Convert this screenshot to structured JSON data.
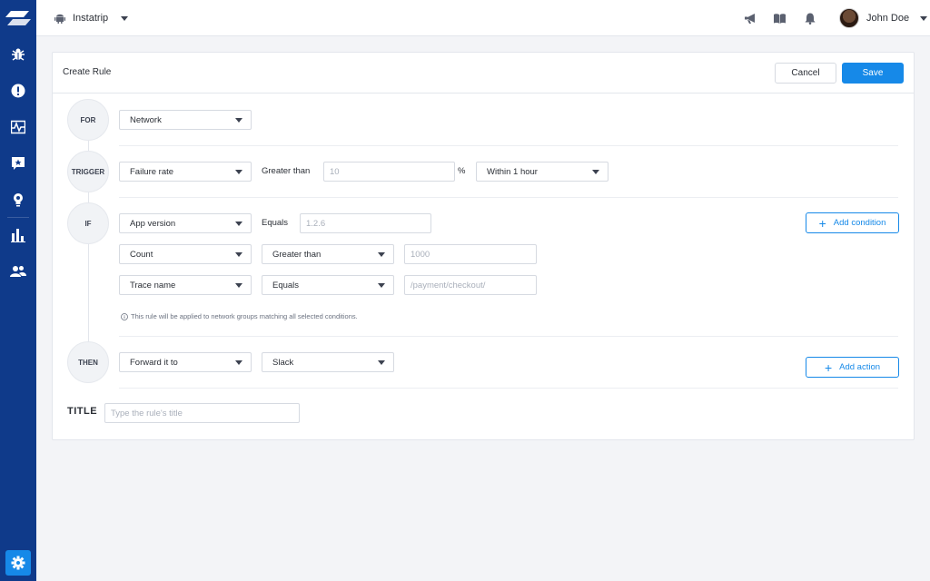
{
  "topbar": {
    "app_name": "Instatrip",
    "user_name": "John Doe"
  },
  "card": {
    "title": "Create Rule",
    "cancel_label": "Cancel",
    "save_label": "Save"
  },
  "steps": {
    "for": "FOR",
    "trigger": "TRIGGER",
    "if": "IF",
    "then": "THEN"
  },
  "for_row": {
    "target": "Network"
  },
  "trigger_row": {
    "metric": "Failure rate",
    "operator": "Greater than",
    "value_placeholder": "10",
    "unit": "%",
    "window": "Within 1 hour"
  },
  "if_rows": [
    {
      "field": "App version",
      "operator": "Equals",
      "value_placeholder": "1.2.6"
    },
    {
      "field": "Count",
      "operator": "Greater than",
      "value_placeholder": "1000"
    },
    {
      "field": "Trace name",
      "operator": "Equals",
      "value_placeholder": "/payment/checkout/"
    }
  ],
  "if_note": "This rule will be applied to network groups matching all selected conditions.",
  "add_condition_label": "Add condition",
  "then_row": {
    "action": "Forward it to",
    "destination": "Slack"
  },
  "add_action_label": "Add action",
  "title_field": {
    "label": "TITLE",
    "placeholder": "Type the rule's title"
  },
  "colors": {
    "sidebar": "#0f3a8a",
    "accent": "#1689e8",
    "background": "#f3f4f7"
  },
  "icons": {
    "sidebar": [
      "bug-icon",
      "alert-icon",
      "activity-icon",
      "feedback-icon",
      "lightbulb-icon",
      "bar-chart-icon",
      "users-icon",
      "gear-icon"
    ],
    "topbar": [
      "android-icon",
      "megaphone-icon",
      "book-icon",
      "bell-icon"
    ]
  }
}
